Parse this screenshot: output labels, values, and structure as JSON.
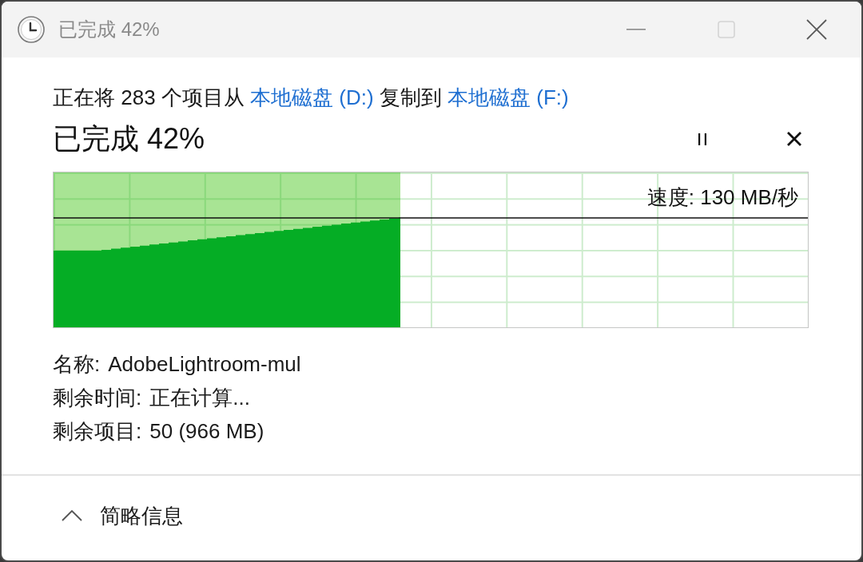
{
  "window": {
    "title": "已完成 42%",
    "maximize_disabled": true
  },
  "summary": [
    {
      "kind": "text",
      "text": "正在将 283 个项目从 "
    },
    {
      "kind": "link",
      "text": "本地磁盘 (D:)"
    },
    {
      "kind": "text",
      "text": " 复制到 "
    },
    {
      "kind": "link",
      "text": "本地磁盘 (F:)"
    }
  ],
  "progress": {
    "heading": "已完成 42%",
    "level": 0.46,
    "speed_label": "速度: 130 MB/秒"
  },
  "details": [
    {
      "label": "名称:",
      "value": "AdobeLightroom-mul"
    },
    {
      "label": "剩余时间:",
      "value": "正在计算..."
    },
    {
      "label": "剩余项目:",
      "value": "50 (966 MB)"
    }
  ],
  "footer": {
    "label": "简略信息",
    "expanded": true
  }
}
